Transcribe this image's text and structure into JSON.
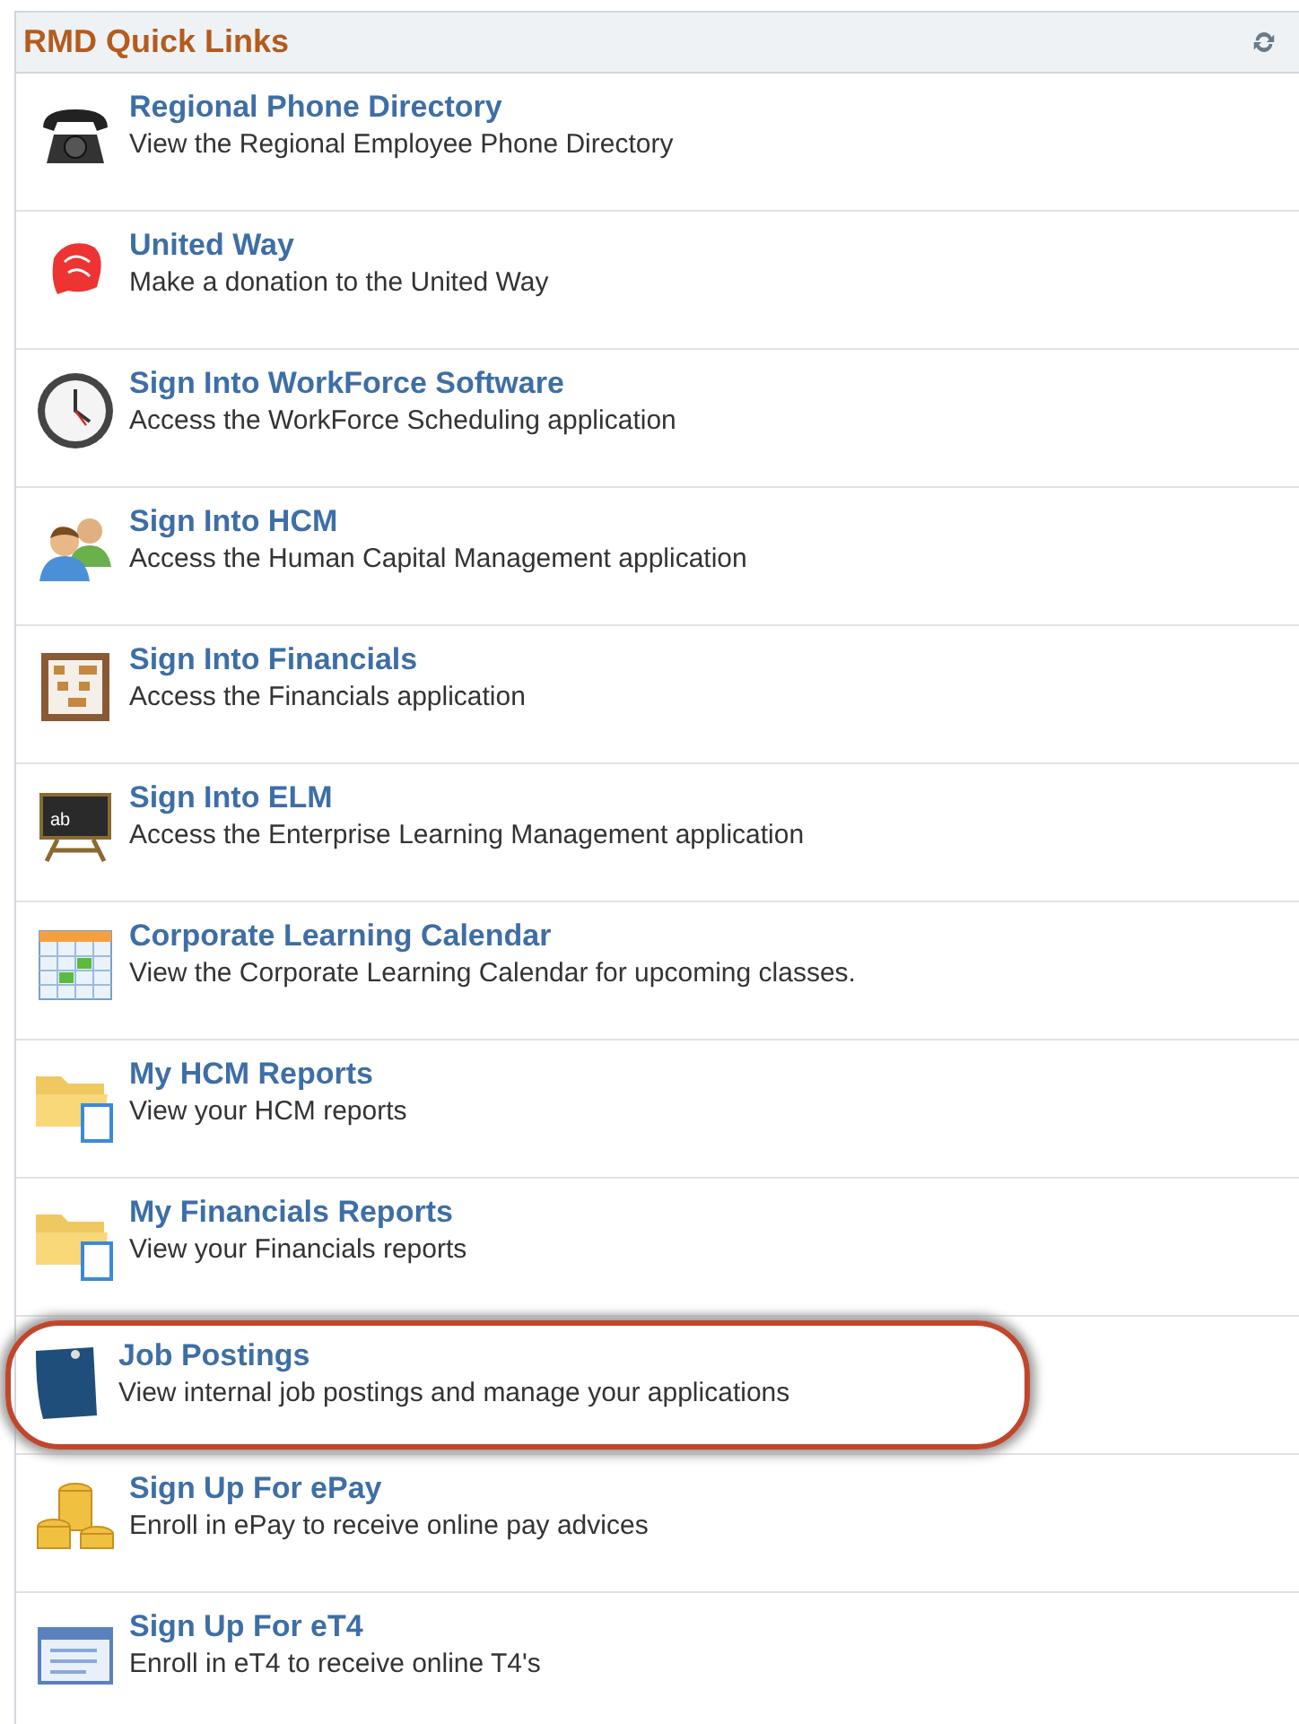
{
  "panel": {
    "title": "RMD Quick Links"
  },
  "links": [
    {
      "kind": "phone",
      "title": "Regional Phone Directory",
      "description": "View the Regional Employee Phone Directory",
      "highlighted": false
    },
    {
      "kind": "hand",
      "title": "United Way",
      "description": "Make a donation to the United Way",
      "highlighted": false
    },
    {
      "kind": "clock",
      "title": "Sign Into WorkForce Software",
      "description": "Access the WorkForce Scheduling application",
      "highlighted": false
    },
    {
      "kind": "people",
      "title": "Sign Into HCM",
      "description": "Access the Human Capital Management application",
      "highlighted": false
    },
    {
      "kind": "abacus",
      "title": "Sign Into Financials",
      "description": "Access the Financials application",
      "highlighted": false
    },
    {
      "kind": "chalkboard",
      "icon_text": "ab",
      "title": "Sign Into ELM",
      "description": "Access the Enterprise Learning Management application",
      "highlighted": false
    },
    {
      "kind": "calendar",
      "title": "Corporate Learning Calendar",
      "description": "View the Corporate Learning Calendar for upcoming classes.",
      "highlighted": false
    },
    {
      "kind": "folder",
      "title": "My HCM Reports",
      "description": "View your HCM reports",
      "highlighted": false
    },
    {
      "kind": "folder",
      "title": "My Financials Reports",
      "description": "View your Financials reports",
      "highlighted": false
    },
    {
      "kind": "note",
      "title": "Job Postings",
      "description": "View internal job postings and manage your applications",
      "highlighted": true
    },
    {
      "kind": "coins",
      "title": "Sign Up For ePay",
      "description": "Enroll in ePay to receive online pay advices",
      "highlighted": false
    },
    {
      "kind": "window",
      "title": "Sign Up For eT4",
      "description": "Enroll in eT4 to receive online T4's",
      "highlighted": false
    }
  ]
}
